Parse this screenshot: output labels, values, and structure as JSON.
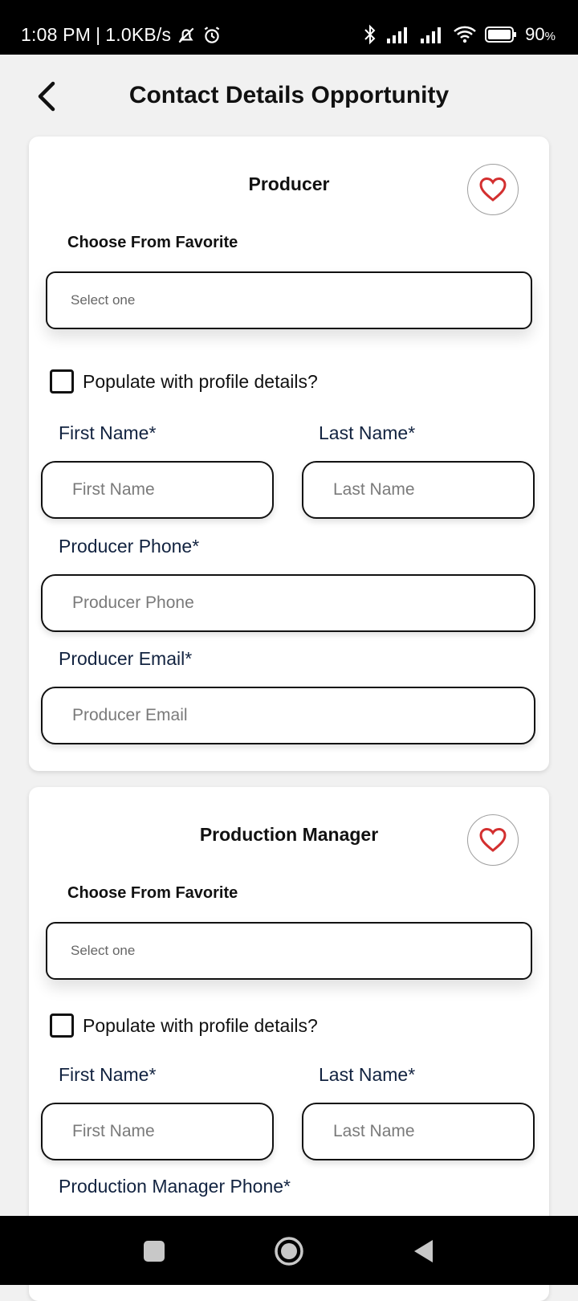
{
  "status_bar": {
    "time": "1:08 PM",
    "separator": "|",
    "speed": "1.0KB/s",
    "battery": "90",
    "battery_unit": "%"
  },
  "header": {
    "title": "Contact Details Opportunity"
  },
  "cards": [
    {
      "title": "Producer",
      "choose_label": "Choose From Favorite",
      "select_placeholder": "Select one",
      "populate_label": "Populate with profile details?",
      "populate_checked": false,
      "first_name_label": "First Name*",
      "first_name_placeholder": "First Name",
      "last_name_label": "Last Name*",
      "last_name_placeholder": "Last Name",
      "phone_label": "Producer Phone*",
      "phone_placeholder": "Producer Phone",
      "email_label": "Producer Email*",
      "email_placeholder": "Producer Email"
    },
    {
      "title": "Production Manager",
      "choose_label": "Choose From Favorite",
      "select_placeholder": "Select one",
      "populate_label": "Populate with profile details?",
      "populate_checked": false,
      "first_name_label": "First Name*",
      "first_name_placeholder": "First Name",
      "last_name_label": "Last Name*",
      "last_name_placeholder": "Last Name",
      "phone_label": "Production Manager Phone*"
    }
  ],
  "icons": {
    "back": "chevron-left-icon",
    "favorite": "heart-icon",
    "nav_recents": "square-icon",
    "nav_home": "circle-icon",
    "nav_back": "triangle-left-icon"
  },
  "colors": {
    "heart": "#d32f2f",
    "label": "#122340",
    "background": "#f1f1f1"
  }
}
